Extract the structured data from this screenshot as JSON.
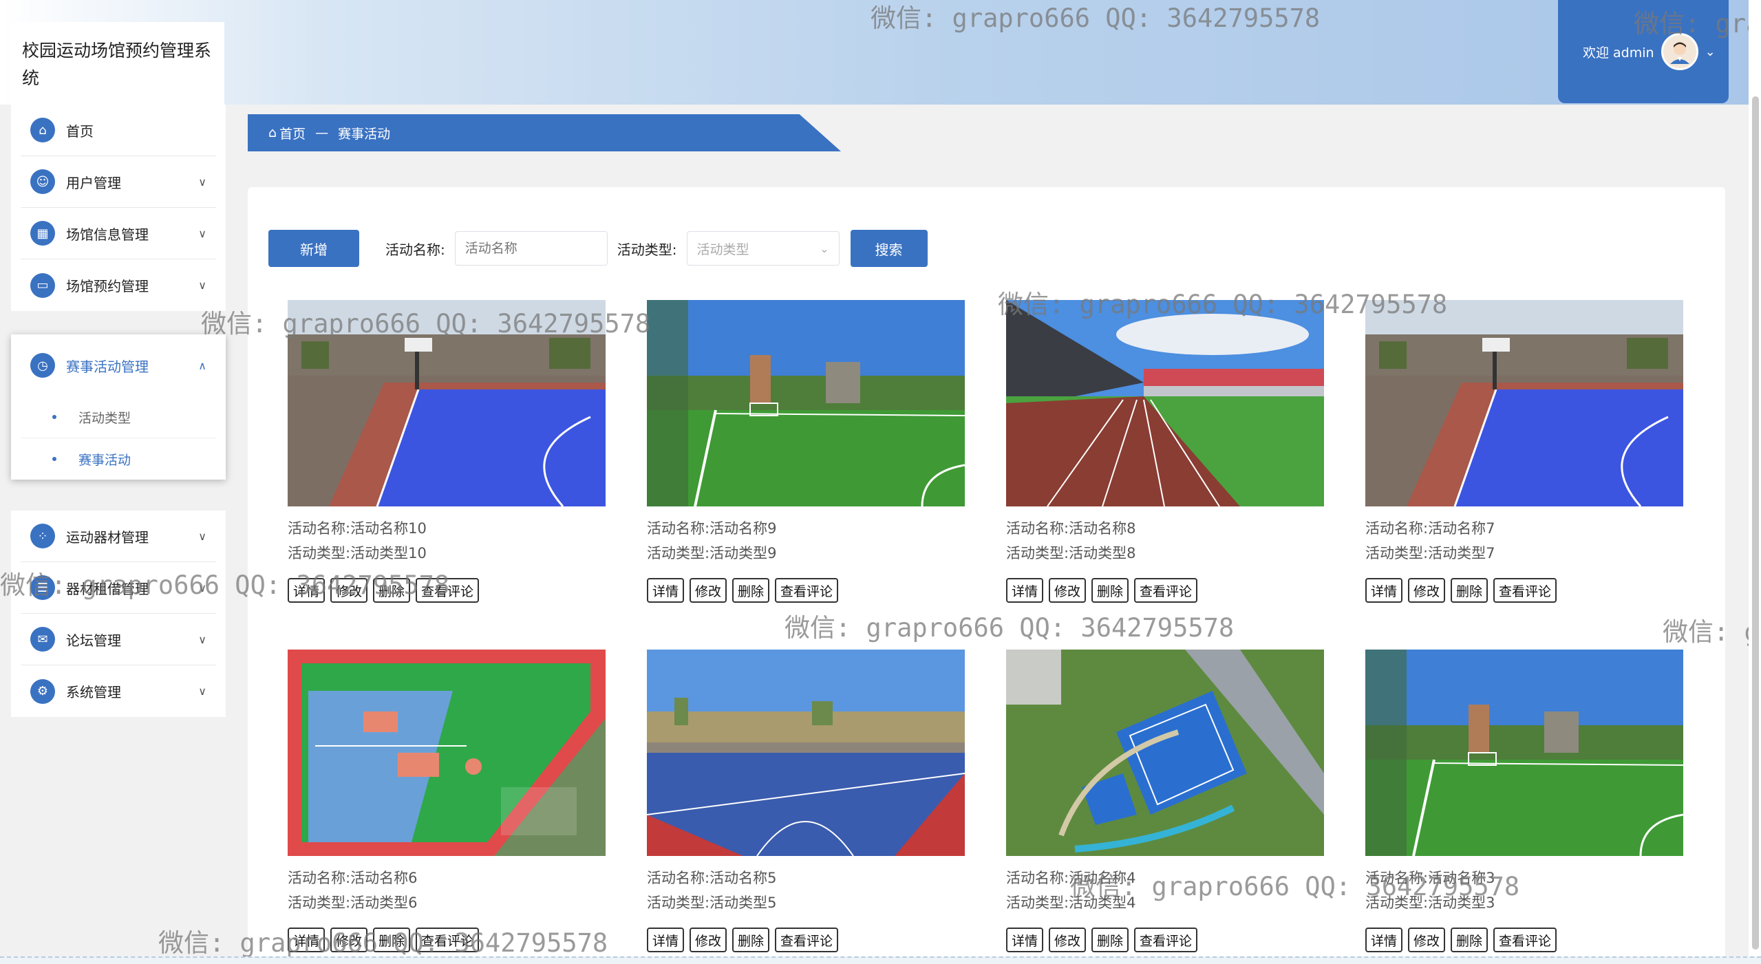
{
  "app": {
    "title": "校园运动场馆预约管理系统"
  },
  "header": {
    "welcome": "欢迎 admin",
    "avatar_icon": "user-avatar-icon"
  },
  "sidebar": {
    "top_items": [
      {
        "label": "首页",
        "icon": "home-icon",
        "has_arrow": false
      },
      {
        "label": "用户管理",
        "icon": "user-icon",
        "has_arrow": true
      },
      {
        "label": "场馆信息管理",
        "icon": "grid-icon",
        "has_arrow": true
      },
      {
        "label": "场馆预约管理",
        "icon": "card-icon",
        "has_arrow": true
      }
    ],
    "active_group": {
      "label": "赛事活动管理",
      "icon": "clock-icon",
      "children": [
        {
          "label": "活动类型"
        },
        {
          "label": "赛事活动"
        }
      ]
    },
    "bottom_items": [
      {
        "label": "运动器材管理",
        "icon": "dots-icon"
      },
      {
        "label": "器材租借管理",
        "icon": "list-icon"
      },
      {
        "label": "论坛管理",
        "icon": "message-icon"
      },
      {
        "label": "系统管理",
        "icon": "settings-icon"
      }
    ]
  },
  "breadcrumb": {
    "home": "首页",
    "separator": "—",
    "current": "赛事活动"
  },
  "toolbar": {
    "add_label": "新增",
    "name_label": "活动名称:",
    "name_placeholder": "活动名称",
    "type_label": "活动类型:",
    "type_placeholder": "活动类型",
    "search_label": "搜索"
  },
  "card_labels": {
    "name_prefix": "活动名称:",
    "type_prefix": "活动类型:",
    "detail": "详情",
    "edit": "修改",
    "delete": "删除",
    "comments": "查看评论"
  },
  "cards": [
    {
      "name": "活动名称10",
      "type": "活动类型10",
      "image": "basketball-court"
    },
    {
      "name": "活动名称9",
      "type": "活动类型9",
      "image": "soccer-field"
    },
    {
      "name": "活动名称8",
      "type": "活动类型8",
      "image": "stadium-track"
    },
    {
      "name": "活动名称7",
      "type": "活动类型7",
      "image": "basketball-court"
    },
    {
      "name": "活动名称6",
      "type": "活动类型6",
      "image": "sports-complex-aerial"
    },
    {
      "name": "活动名称5",
      "type": "活动类型5",
      "image": "blue-court"
    },
    {
      "name": "活动名称4",
      "type": "活动类型4",
      "image": "park-aerial"
    },
    {
      "name": "活动名称3",
      "type": "活动类型3",
      "image": "soccer-field"
    }
  ],
  "watermark": "微信: grapro666 QQ: 3642795578",
  "watermark_partial": "微信: gra",
  "watermark_tiny": "微信: g"
}
